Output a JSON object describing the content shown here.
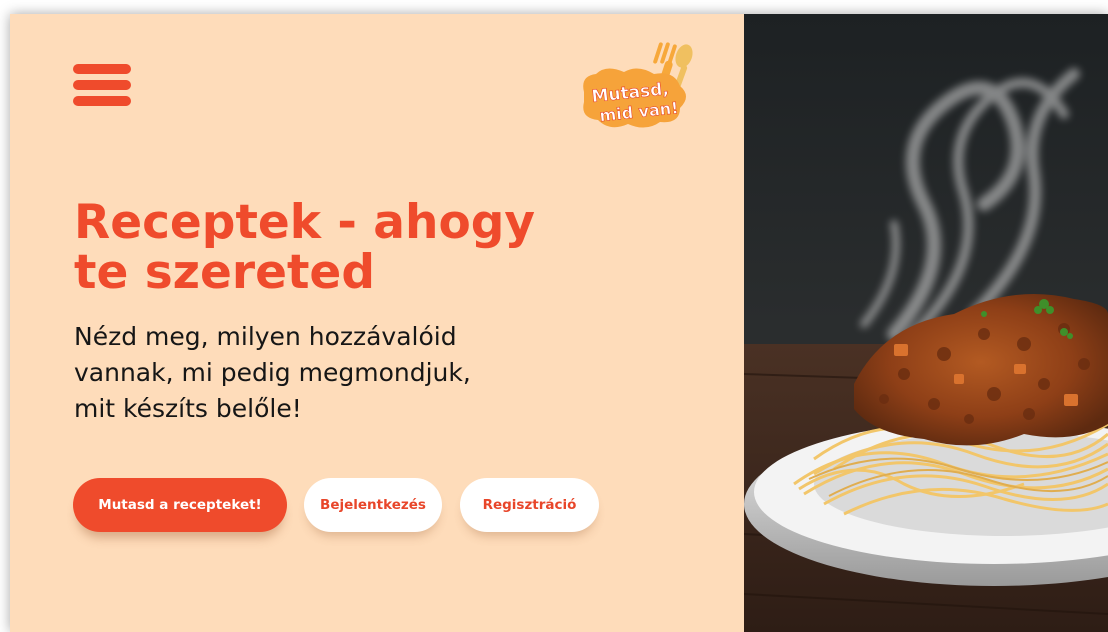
{
  "header": {
    "menu_icon": "hamburger-menu-icon",
    "logo_text_line1": "Mutasd,",
    "logo_text_line2": "mid van!"
  },
  "hero": {
    "title_line1": "Receptek - ahogy",
    "title_line2": "te szereted",
    "subtitle_line1": "Nézd meg, milyen hozzávalóid",
    "subtitle_line2": "vannak, mi pedig megmondjuk,",
    "subtitle_line3": "mit készíts belőle!"
  },
  "actions": {
    "show_recipes_label": "Mutasd a recepteket!",
    "login_label": "Bejelentkezés",
    "register_label": "Regisztráció"
  },
  "colors": {
    "background": "#fedcba",
    "accent": "#ef4b2c",
    "text": "#161616"
  }
}
